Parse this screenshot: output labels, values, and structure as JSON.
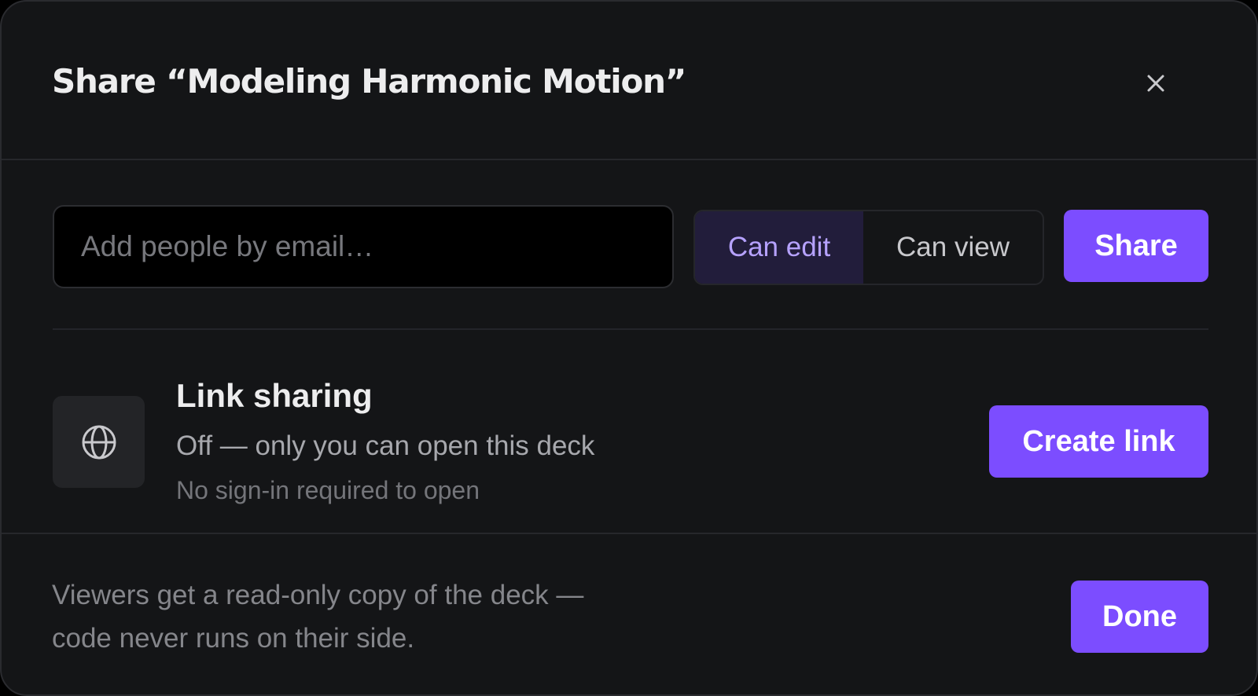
{
  "dialog": {
    "title": "Share “Modeling Harmonic Motion”",
    "close_icon": "close-icon"
  },
  "invite": {
    "email_placeholder": "Add people by email…",
    "email_value": "",
    "permissions": [
      {
        "label": "Can edit",
        "selected": true
      },
      {
        "label": "Can view",
        "selected": false
      }
    ],
    "share_label": "Share"
  },
  "link_sharing": {
    "icon": "globe-icon",
    "title": "Link sharing",
    "status": "Off — only you can open this deck",
    "note": "No sign-in required to open",
    "create_label": "Create link"
  },
  "footer": {
    "note": "Viewers get a read-only copy of the deck — code never runs on their side.",
    "done_label": "Done"
  },
  "colors": {
    "background": "#141517",
    "accent": "#7c4dff",
    "selected_segment_bg": "#221d3b",
    "selected_segment_text": "#b6a2ff"
  }
}
